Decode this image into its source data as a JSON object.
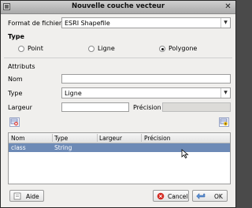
{
  "window": {
    "title": "Nouvelle couche vecteur"
  },
  "format": {
    "label": "Format de fichier",
    "value": "ESRI Shapefile"
  },
  "type_group": {
    "label": "Type",
    "options": [
      {
        "label": "Point",
        "checked": false
      },
      {
        "label": "Ligne",
        "checked": false
      },
      {
        "label": "Polygone",
        "checked": true
      }
    ]
  },
  "attributes": {
    "section_label": "Attributs",
    "name_label": "Nom",
    "name_value": "",
    "type_label": "Type",
    "type_value": "Ligne",
    "width_label": "Largeur",
    "width_value": "",
    "precision_label": "Précision",
    "precision_value": ""
  },
  "table": {
    "columns": [
      "Nom",
      "Type",
      "Largeur",
      "Précision"
    ],
    "rows": [
      {
        "nom": "class",
        "type": "String",
        "largeur": "",
        "precision": ""
      }
    ]
  },
  "buttons": {
    "help": "Aide",
    "cancel": "Cancel",
    "ok": "OK"
  }
}
